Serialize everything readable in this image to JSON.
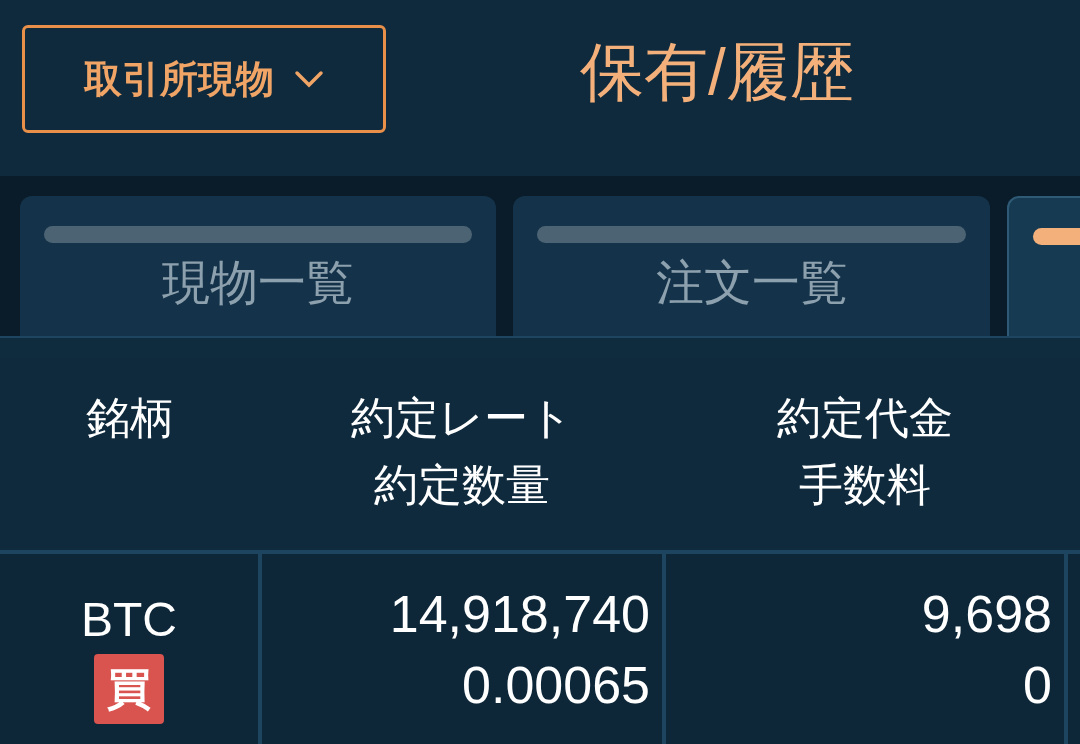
{
  "header": {
    "market_dropdown": "取引所現物",
    "title": "保有/履歴"
  },
  "tabs": [
    {
      "label": "現物一覧",
      "selected": false
    },
    {
      "label": "注文一覧",
      "selected": false
    },
    {
      "selected": true
    }
  ],
  "table": {
    "columns": [
      {
        "lines": [
          "銘柄"
        ]
      },
      {
        "lines": [
          "約定レート",
          "約定数量"
        ]
      },
      {
        "lines": [
          "約定代金",
          "手数料"
        ]
      }
    ],
    "rows": [
      {
        "symbol": "BTC",
        "side": {
          "label": "買",
          "kind": "buy"
        },
        "rate": "14,918,740",
        "quantity": "0.00065",
        "amount": "9,698",
        "fee": "0"
      }
    ]
  }
}
